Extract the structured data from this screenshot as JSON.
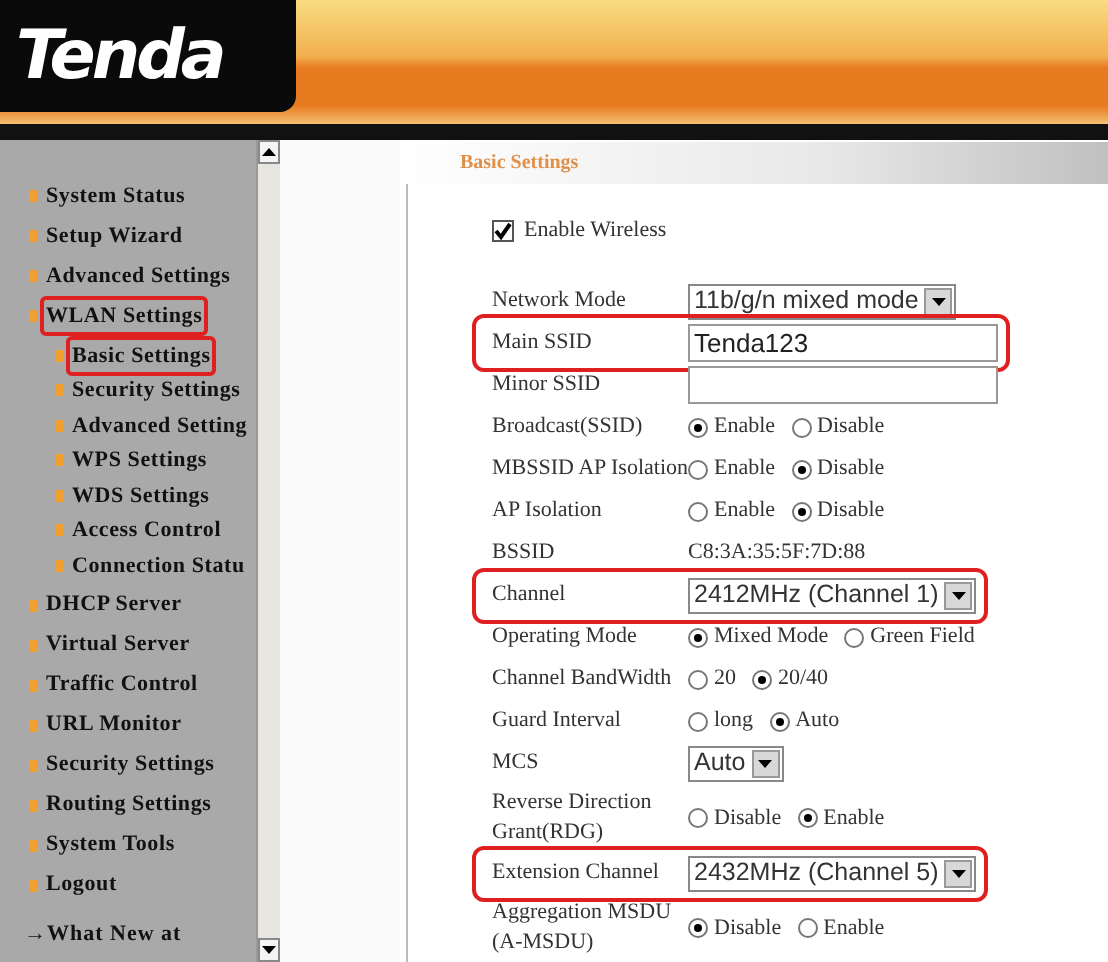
{
  "header": {
    "logo": "Tenda"
  },
  "sidebar": {
    "items": [
      {
        "label": "System Status",
        "highlighted": false
      },
      {
        "label": "Setup Wizard",
        "highlighted": false
      },
      {
        "label": "Advanced Settings",
        "highlighted": false
      },
      {
        "label": "WLAN Settings",
        "highlighted": true,
        "children": [
          {
            "label": "Basic Settings",
            "highlighted": true
          },
          {
            "label": "Security Settings",
            "highlighted": false
          },
          {
            "label": "Advanced Setting",
            "highlighted": false
          },
          {
            "label": "WPS Settings",
            "highlighted": false
          },
          {
            "label": "WDS Settings",
            "highlighted": false
          },
          {
            "label": "Access Control",
            "highlighted": false
          },
          {
            "label": "Connection Statu",
            "highlighted": false
          }
        ]
      },
      {
        "label": "DHCP Server",
        "highlighted": false
      },
      {
        "label": "Virtual Server",
        "highlighted": false
      },
      {
        "label": "Traffic Control",
        "highlighted": false
      },
      {
        "label": "URL Monitor",
        "highlighted": false
      },
      {
        "label": "Security Settings",
        "highlighted": false
      },
      {
        "label": "Routing Settings",
        "highlighted": false
      },
      {
        "label": "System Tools",
        "highlighted": false
      },
      {
        "label": "Logout",
        "highlighted": false
      }
    ],
    "footer_link": {
      "arrow": "→",
      "label": "What New at"
    }
  },
  "main": {
    "title": "Basic Settings",
    "enable_wireless": {
      "label": "Enable Wireless",
      "checked": true
    },
    "rows": [
      {
        "kind": "select",
        "label": "Network Mode",
        "value": "11b/g/n mixed mode",
        "highlighted": false
      },
      {
        "kind": "text",
        "label": "Main SSID",
        "value": "Tenda123",
        "highlighted": true
      },
      {
        "kind": "text",
        "label": "Minor SSID",
        "highlighted": false
      },
      {
        "kind": "radio",
        "label": "Broadcast(SSID)",
        "options": [
          {
            "label": "Enable",
            "selected": true
          },
          {
            "label": "Disable",
            "selected": false
          }
        ],
        "highlighted": false
      },
      {
        "kind": "radio",
        "label": "MBSSID AP Isolation",
        "options": [
          {
            "label": "Enable",
            "selected": false
          },
          {
            "label": "Disable",
            "selected": true
          }
        ],
        "highlighted": false
      },
      {
        "kind": "radio",
        "label": "AP Isolation",
        "options": [
          {
            "label": "Enable",
            "selected": false
          },
          {
            "label": "Disable",
            "selected": true
          }
        ],
        "highlighted": false
      },
      {
        "kind": "value",
        "label": "BSSID",
        "value": "C8:3A:35:5F:7D:88",
        "highlighted": false
      },
      {
        "kind": "select",
        "label": "Channel",
        "value": "2412MHz (Channel 1)",
        "highlighted": true
      },
      {
        "kind": "radio",
        "label": "Operating Mode",
        "options": [
          {
            "label": "Mixed Mode",
            "selected": true
          },
          {
            "label": "Green Field",
            "selected": false
          }
        ],
        "highlighted": false
      },
      {
        "kind": "radio",
        "label": "Channel BandWidth",
        "options": [
          {
            "label": "20",
            "selected": false
          },
          {
            "label": "20/40",
            "selected": true
          }
        ],
        "highlighted": false
      },
      {
        "kind": "radio",
        "label": "Guard Interval",
        "options": [
          {
            "label": "long",
            "selected": false
          },
          {
            "label": "Auto",
            "selected": true
          }
        ],
        "highlighted": false
      },
      {
        "kind": "select",
        "label": "MCS",
        "value": "Auto",
        "highlighted": false
      },
      {
        "kind": "radio",
        "label": "Reverse Direction Grant(RDG)",
        "options": [
          {
            "label": "Disable",
            "selected": false
          },
          {
            "label": "Enable",
            "selected": true
          }
        ],
        "highlighted": false
      },
      {
        "kind": "select",
        "label": "Extension Channel",
        "value": "2432MHz (Channel 5)",
        "highlighted": true
      },
      {
        "kind": "radio",
        "label": "Aggregation MSDU (A-MSDU)",
        "options": [
          {
            "label": "Disable",
            "selected": true
          },
          {
            "label": "Enable",
            "selected": false
          }
        ],
        "highlighted": false
      }
    ]
  }
}
